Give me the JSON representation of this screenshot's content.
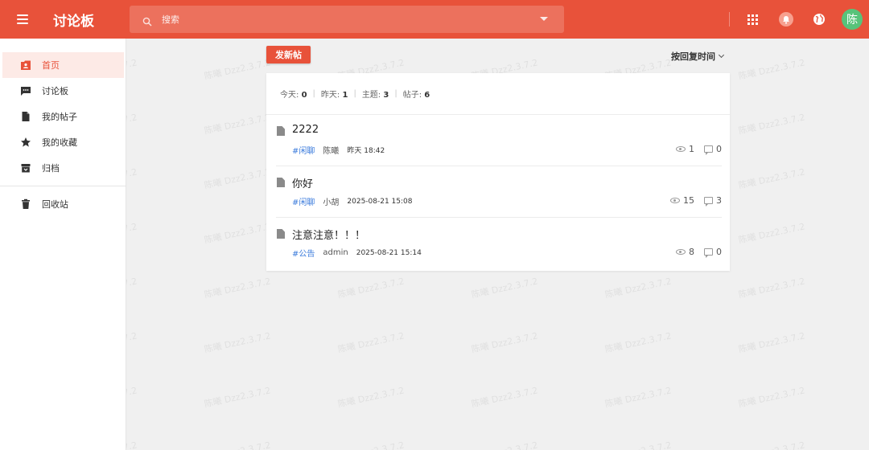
{
  "header": {
    "brand": "讨论板",
    "search": {
      "placeholder": "搜索"
    },
    "avatar_letter": "陈",
    "accent_color": "#e8523a"
  },
  "watermark": "陈曦 Dzz2.3.7.2",
  "sidebar": {
    "items": [
      {
        "label": "首页",
        "icon": "home-icon",
        "active": true
      },
      {
        "label": "讨论板",
        "icon": "forum-icon"
      },
      {
        "label": "我的帖子",
        "icon": "document-icon"
      },
      {
        "label": "我的收藏",
        "icon": "star-icon"
      },
      {
        "label": "归档",
        "icon": "archive-icon"
      },
      {
        "label": "回收站",
        "icon": "trash-icon"
      }
    ]
  },
  "main": {
    "new_post_label": "发新帖",
    "sort_label": "按回复时间",
    "stats": {
      "today_label": "今天:",
      "today": "0",
      "yesterday_label": "昨天:",
      "yesterday": "1",
      "topics_label": "主题:",
      "topics": "3",
      "posts_label": "帖子:",
      "posts": "6"
    },
    "posts": [
      {
        "title": "2222",
        "tag": "#闲聊",
        "author": "陈曦",
        "time": "昨天 18:42",
        "views": "1",
        "replies": "0"
      },
      {
        "title": "你好",
        "tag": "#闲聊",
        "author": "小胡",
        "time": "2025-08-21 15:08",
        "views": "15",
        "replies": "3"
      },
      {
        "title": "注意注意！！！",
        "tag": "#公告",
        "author": "admin",
        "time": "2025-08-21 15:14",
        "views": "8",
        "replies": "0"
      }
    ]
  }
}
